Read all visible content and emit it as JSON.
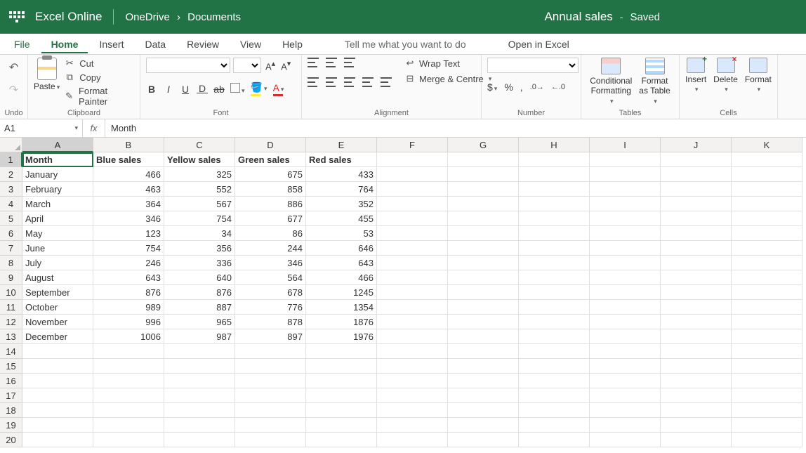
{
  "header": {
    "app": "Excel Online",
    "breadcrumb": [
      "OneDrive",
      "Documents"
    ],
    "sep": "›",
    "doc": "Annual sales",
    "saved": "Saved"
  },
  "menu": {
    "file": "File",
    "home": "Home",
    "insert": "Insert",
    "data": "Data",
    "review": "Review",
    "view": "View",
    "help": "Help",
    "tellme": "Tell me what you want to do",
    "open": "Open in Excel"
  },
  "ribbon": {
    "undo_label": "Undo",
    "paste": "Paste",
    "cut": "Cut",
    "copy": "Copy",
    "format_painter": "Format Painter",
    "clipboard": "Clipboard",
    "font": "Font",
    "alignment": "Alignment",
    "wrap": "Wrap Text",
    "merge": "Merge & Centre",
    "number": "Number",
    "cond_fmt": "Conditional\nFormatting",
    "as_table": "Format\nas Table",
    "tables": "Tables",
    "insert_btn": "Insert",
    "delete_btn": "Delete",
    "format_btn": "Format",
    "cells": "Cells"
  },
  "formula": {
    "name_box": "A1",
    "value": "Month"
  },
  "columns": [
    "A",
    "B",
    "C",
    "D",
    "E",
    "F",
    "G",
    "H",
    "I",
    "J",
    "K"
  ],
  "row_count": 20,
  "data": {
    "headers": [
      "Month",
      "Blue sales",
      "Yellow sales",
      "Green sales",
      "Red sales"
    ],
    "rows": [
      [
        "January",
        466,
        325,
        675,
        433
      ],
      [
        "February",
        463,
        552,
        858,
        764
      ],
      [
        "March",
        364,
        567,
        886,
        352
      ],
      [
        "April",
        346,
        754,
        677,
        455
      ],
      [
        "May",
        123,
        34,
        86,
        53
      ],
      [
        "June",
        754,
        356,
        244,
        646
      ],
      [
        "July",
        246,
        336,
        346,
        643
      ],
      [
        "August",
        643,
        640,
        564,
        466
      ],
      [
        "September",
        876,
        876,
        678,
        1245
      ],
      [
        "October",
        989,
        887,
        776,
        1354
      ],
      [
        "November",
        996,
        965,
        878,
        1876
      ],
      [
        "December",
        1006,
        987,
        897,
        1976
      ]
    ]
  },
  "active_cell": {
    "row": 1,
    "col": 0
  }
}
